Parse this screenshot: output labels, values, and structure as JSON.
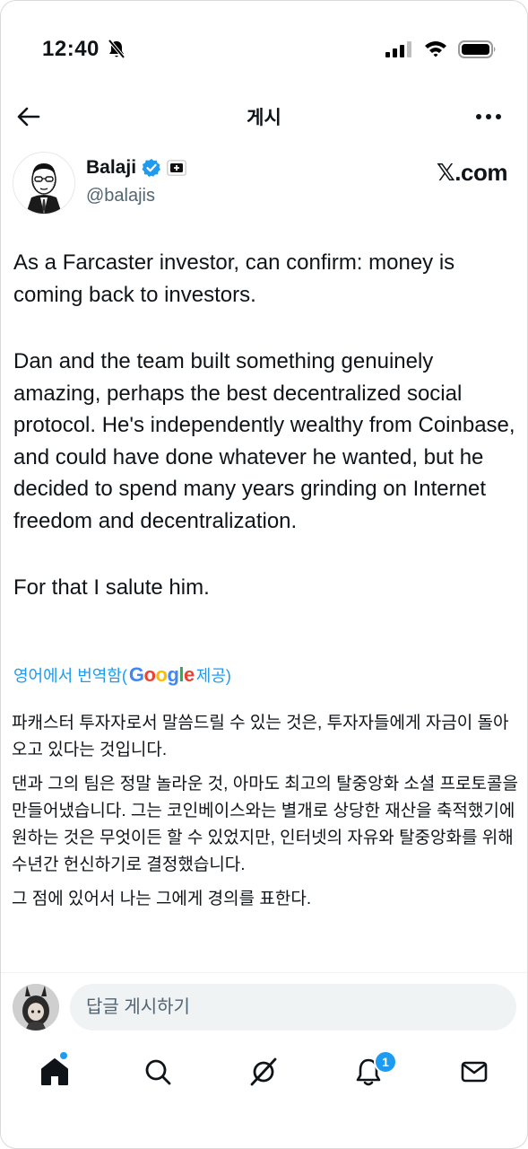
{
  "status_bar": {
    "time": "12:40",
    "icons": [
      "bell-slash-icon",
      "signal-icon",
      "wifi-icon",
      "battery-icon"
    ]
  },
  "header": {
    "title": "게시",
    "back_icon": "arrow-left-icon",
    "more_icon": "more-horizontal-icon"
  },
  "post": {
    "author_name": "Balaji",
    "author_handle": "@balajis",
    "verified_color": "#1d9bf0",
    "source": "𝕏.com",
    "paragraphs": [
      "As a Farcaster investor, can confirm: money is coming back to investors.",
      "Dan and the team built something genuinely amazing, perhaps the best decentralized social protocol. He's independently wealthy from Coinbase, and could have done whatever he wanted, but he decided to spend many years grinding on Internet freedom and decentralization.",
      "For that I salute him."
    ],
    "translate_prefix": "영어에서 번역함(",
    "translate_brand": "Google",
    "translate_suffix": " 제공)",
    "translation": [
      "파캐스터 투자자로서 말씀드릴 수 있는 것은, 투자자들에게 자금이 돌아오고 있다는 것입니다.",
      "댄과 그의 팀은 정말 놀라운 것, 아마도 최고의 탈중앙화 소셜 프로토콜을 만들어냈습니다. 그는 코인베이스와는 별개로 상당한 재산을 축적했기에 원하는 것은 무엇이든 할 수 있었지만, 인터넷의 자유와 탈중앙화를 위해 수년간 헌신하기로 결정했습니다.",
      "그 점에 있어서 나는 그에게 경의를 표한다."
    ]
  },
  "reply": {
    "placeholder": "답글 게시하기"
  },
  "tabbar": {
    "items": [
      "home-icon",
      "search-icon",
      "grok-icon",
      "notifications-icon",
      "messages-icon"
    ],
    "notification_count": "1",
    "accent": "#1d9bf0"
  }
}
